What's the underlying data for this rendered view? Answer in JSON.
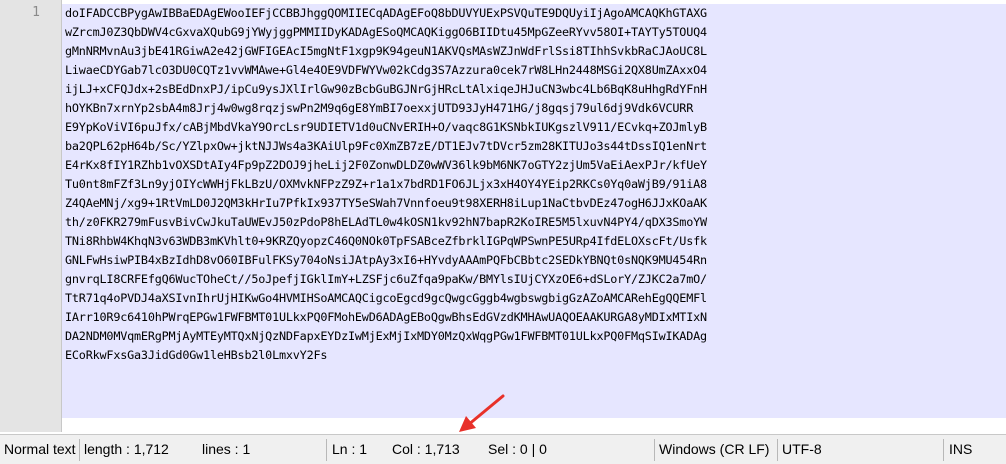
{
  "gutter": {
    "line_number": "1"
  },
  "document": {
    "lines": [
      "doIFADCCBPygAwIBBaEDAgEWooIEFjCCBBJhggQOMIIECqADAgEFoQ8bDUVYUExPSVQuTE9DQUyiIjAgoAMCAQKhGTAXG",
      "wZrcmJ0Z3QbDWV4cGxvaXQubG9jYWyjggPMMIIDyKADAgESoQMCAQKiggO6BIIDtu45MpGZeeRYvv58OI+TAYTy5TOUQ4",
      "gMnNRMvnAu3jbE41RGiwA2e42jGWFIGEAcI5mgNtF1xgp9K94geuN1AKVQsMAsWZJnWdFrlSsi8TIhhSvkbRaCJAoUC8L",
      "LiwaeCDYGab7lcO3DU0CQTz1vvWMAwe+Gl4e4OE9VDFWYVw02kCdg3S7Azzura0cek7rW8LHn2448MSGi2QX8UmZAxxO4",
      "ijLJ+xCFQJdx+2sBEdDnxPJ/ipCu9ysJXlIrlGw90zBcbGuBGJNrGjHRcLtAlxiqeJHJuCN3wbc4Lb6BqK8uHhgRdYFnH",
      "hOYKBn7xrnYp2sbA4m8Jrj4w0wg8rqzjswPn2M9q6gE8YmBI7oexxjUTD93JyH471HG/j8gqsj79ul6dj9Vdk6VCURR",
      "E9YpKoViVI6puJfx/cABjMbdVkaY9OrcLsr9UDIETV1d0uCNvERIH+O/vaqc8G1KSNbkIUKgszlV911/ECvkq+ZOJmlyB",
      "ba2QPL62pH64b/Sc/YZlpxOw+jktNJJWs4a3KAiUlp9Fc0XmZB7zE/DT1EJv7tDVcr5zm28KITUJo3s44tDssIQ1enNrt",
      "E4rKx8fIY1RZhb1vOXSDtAIy4Fp9pZ2DOJ9jheLij2F0ZonwDLDZ0wWV36lk9bM6NK7oGTY2zjUm5VaEiAexPJr/kfUeY",
      "Tu0nt8mFZf3Ln9yjOIYcWWHjFkLBzU/OXMvkNFPzZ9Z+r1a1x7bdRD1FO6JLjx3xH4OY4YEip2RKCs0Yq0aWjB9/91iA8",
      "Z4QAeMNj/xg9+1RtVmLD0J2QM3kHrIu7PfkIx937TY5eSWah7Vnnfoeu9t98XERH8iLup1NaCtbvDEz47ogH6JJxKOaAK",
      "th/z0FKR279mFusvBivCwJkuTaUWEvJ50zPdoP8hELAdTL0w4kOSN1kv92hN7bapR2KoIRE5M5lxuvN4PY4/qDX3SmoYW",
      "TNi8RhbW4KhqN3v63WDB3mKVhlt0+9KRZQyopzC46Q0NOk0TpFSABceZfbrklIGPqWPSwnPE5URp4IfdELOXscFt/Usfk",
      "GNLFwHsiwPIB4xBzIdhD8vO60IBFulFKSy704oNsiJAtpAy3xI6+HYvdyAAAmPQFbCBbtc2SEDkYBNQt0sNQK9MU454Rn",
      "gnvrqLI8CRFEfgQ6WucTOheCt//5oJpefjIGklImY+LZSFjc6uZfqa9paKw/BMYlsIUjCYXzOE6+dSLorY/ZJKC2a7mO/",
      "TtR71q4oPVDJ4aXSIvnIhrUjHIKwGo4HVMIHSoAMCAQCigcoEgcd9gcQwgcGggb4wgbswgbigGzAZoAMCARehEgQQEMFl",
      "IArr10R9c6410hPWrqEPGw1FWFBMT01ULkxPQ0FMohEwD6ADAgEBoQgwBhsEdGVzdKMHAwUAQOEAAKURGA8yMDIxMTIxN",
      "DA2NDM0MVqmERgPMjAyMTEyMTQxNjQzNDFapxEYDzIwMjExMjIxMDY0MzQxWqgPGw1FWFBMT01ULkxPQ0FMqSIwIKADAg",
      "ECoRkwFxsGa3JidGd0Gw1leHBsb2l0LmxvY2Fs"
    ]
  },
  "status": {
    "lang": "Normal text file",
    "length": "length : 1,712",
    "lines": "lines : 1",
    "ln": "Ln : 1",
    "col": "Col : 1,713",
    "sel": "Sel : 0 | 0",
    "eol": "Windows (CR LF)",
    "encoding": "UTF-8",
    "ins": "INS"
  },
  "annotation": {
    "arrow_color": "#e8312a",
    "icon": "arrow-icon"
  }
}
